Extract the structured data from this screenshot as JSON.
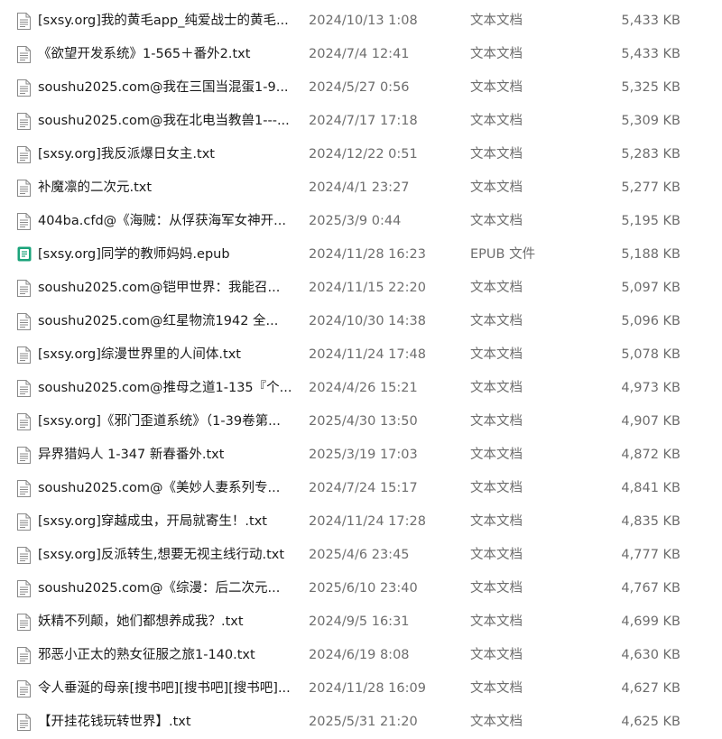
{
  "icons": {
    "txt": "text-document-icon",
    "epub": "epub-file-icon"
  },
  "colors": {
    "row_hover": "#e5f3ff",
    "epub_accent": "#1aa37a",
    "secondary_text": "#6d6d6d"
  },
  "files": [
    {
      "name": "[sxsy.org]我的黄毛app_纯爱战士的黄毛...",
      "date": "2024/10/13 1:08",
      "type": "文本文档",
      "size": "5,433 KB",
      "icon": "txt"
    },
    {
      "name": "《欲望开发系统》1-565＋番外2.txt",
      "date": "2024/7/4 12:41",
      "type": "文本文档",
      "size": "5,433 KB",
      "icon": "txt"
    },
    {
      "name": "soushu2025.com@我在三国当混蛋1-9...",
      "date": "2024/5/27 0:56",
      "type": "文本文档",
      "size": "5,325 KB",
      "icon": "txt"
    },
    {
      "name": "soushu2025.com@我在北电当教兽1---...",
      "date": "2024/7/17 17:18",
      "type": "文本文档",
      "size": "5,309 KB",
      "icon": "txt"
    },
    {
      "name": "[sxsy.org]我反派爆日女主.txt",
      "date": "2024/12/22 0:51",
      "type": "文本文档",
      "size": "5,283 KB",
      "icon": "txt"
    },
    {
      "name": "补魔凛的二次元.txt",
      "date": "2024/4/1 23:27",
      "type": "文本文档",
      "size": "5,277 KB",
      "icon": "txt"
    },
    {
      "name": "404ba.cfd@《海贼：从俘获海军女神开...",
      "date": "2025/3/9 0:44",
      "type": "文本文档",
      "size": "5,195 KB",
      "icon": "txt"
    },
    {
      "name": "[sxsy.org]同学的教师妈妈.epub",
      "date": "2024/11/28 16:23",
      "type": "EPUB 文件",
      "size": "5,188 KB",
      "icon": "epub"
    },
    {
      "name": "soushu2025.com@铠甲世界：我能召...",
      "date": "2024/11/15 22:20",
      "type": "文本文档",
      "size": "5,097 KB",
      "icon": "txt"
    },
    {
      "name": "soushu2025.com@红星物流1942 全...",
      "date": "2024/10/30 14:38",
      "type": "文本文档",
      "size": "5,096 KB",
      "icon": "txt"
    },
    {
      "name": "[sxsy.org]综漫世界里的人间体.txt",
      "date": "2024/11/24 17:48",
      "type": "文本文档",
      "size": "5,078 KB",
      "icon": "txt"
    },
    {
      "name": "soushu2025.com@推母之道1-135『个...",
      "date": "2024/4/26 15:21",
      "type": "文本文档",
      "size": "4,973 KB",
      "icon": "txt"
    },
    {
      "name": "[sxsy.org]《邪门歪道系统》（1-39卷第...",
      "date": "2025/4/30 13:50",
      "type": "文本文档",
      "size": "4,907 KB",
      "icon": "txt"
    },
    {
      "name": "异界猎妈人 1-347 新春番外.txt",
      "date": "2025/3/19 17:03",
      "type": "文本文档",
      "size": "4,872 KB",
      "icon": "txt"
    },
    {
      "name": "soushu2025.com@《美妙人妻系列专...",
      "date": "2024/7/24 15:17",
      "type": "文本文档",
      "size": "4,841 KB",
      "icon": "txt"
    },
    {
      "name": "[sxsy.org]穿越成虫，开局就寄生！.txt",
      "date": "2024/11/24 17:28",
      "type": "文本文档",
      "size": "4,835 KB",
      "icon": "txt"
    },
    {
      "name": "[sxsy.org]反派转生,想要无视主线行动.txt",
      "date": "2025/4/6 23:45",
      "type": "文本文档",
      "size": "4,777 KB",
      "icon": "txt"
    },
    {
      "name": "soushu2025.com@《综漫：后二次元...",
      "date": "2025/6/10 23:40",
      "type": "文本文档",
      "size": "4,767 KB",
      "icon": "txt"
    },
    {
      "name": "妖精不列颠，她们都想养成我？.txt",
      "date": "2024/9/5 16:31",
      "type": "文本文档",
      "size": "4,699 KB",
      "icon": "txt"
    },
    {
      "name": "邪恶小正太的熟女征服之旅1-140.txt",
      "date": "2024/6/19 8:08",
      "type": "文本文档",
      "size": "4,630 KB",
      "icon": "txt"
    },
    {
      "name": "令人垂涎的母亲[搜书吧][搜书吧][搜书吧]...",
      "date": "2024/11/28 16:09",
      "type": "文本文档",
      "size": "4,627 KB",
      "icon": "txt"
    },
    {
      "name": "【开挂花钱玩转世界】.txt",
      "date": "2025/5/31 21:20",
      "type": "文本文档",
      "size": "4,625 KB",
      "icon": "txt"
    }
  ]
}
